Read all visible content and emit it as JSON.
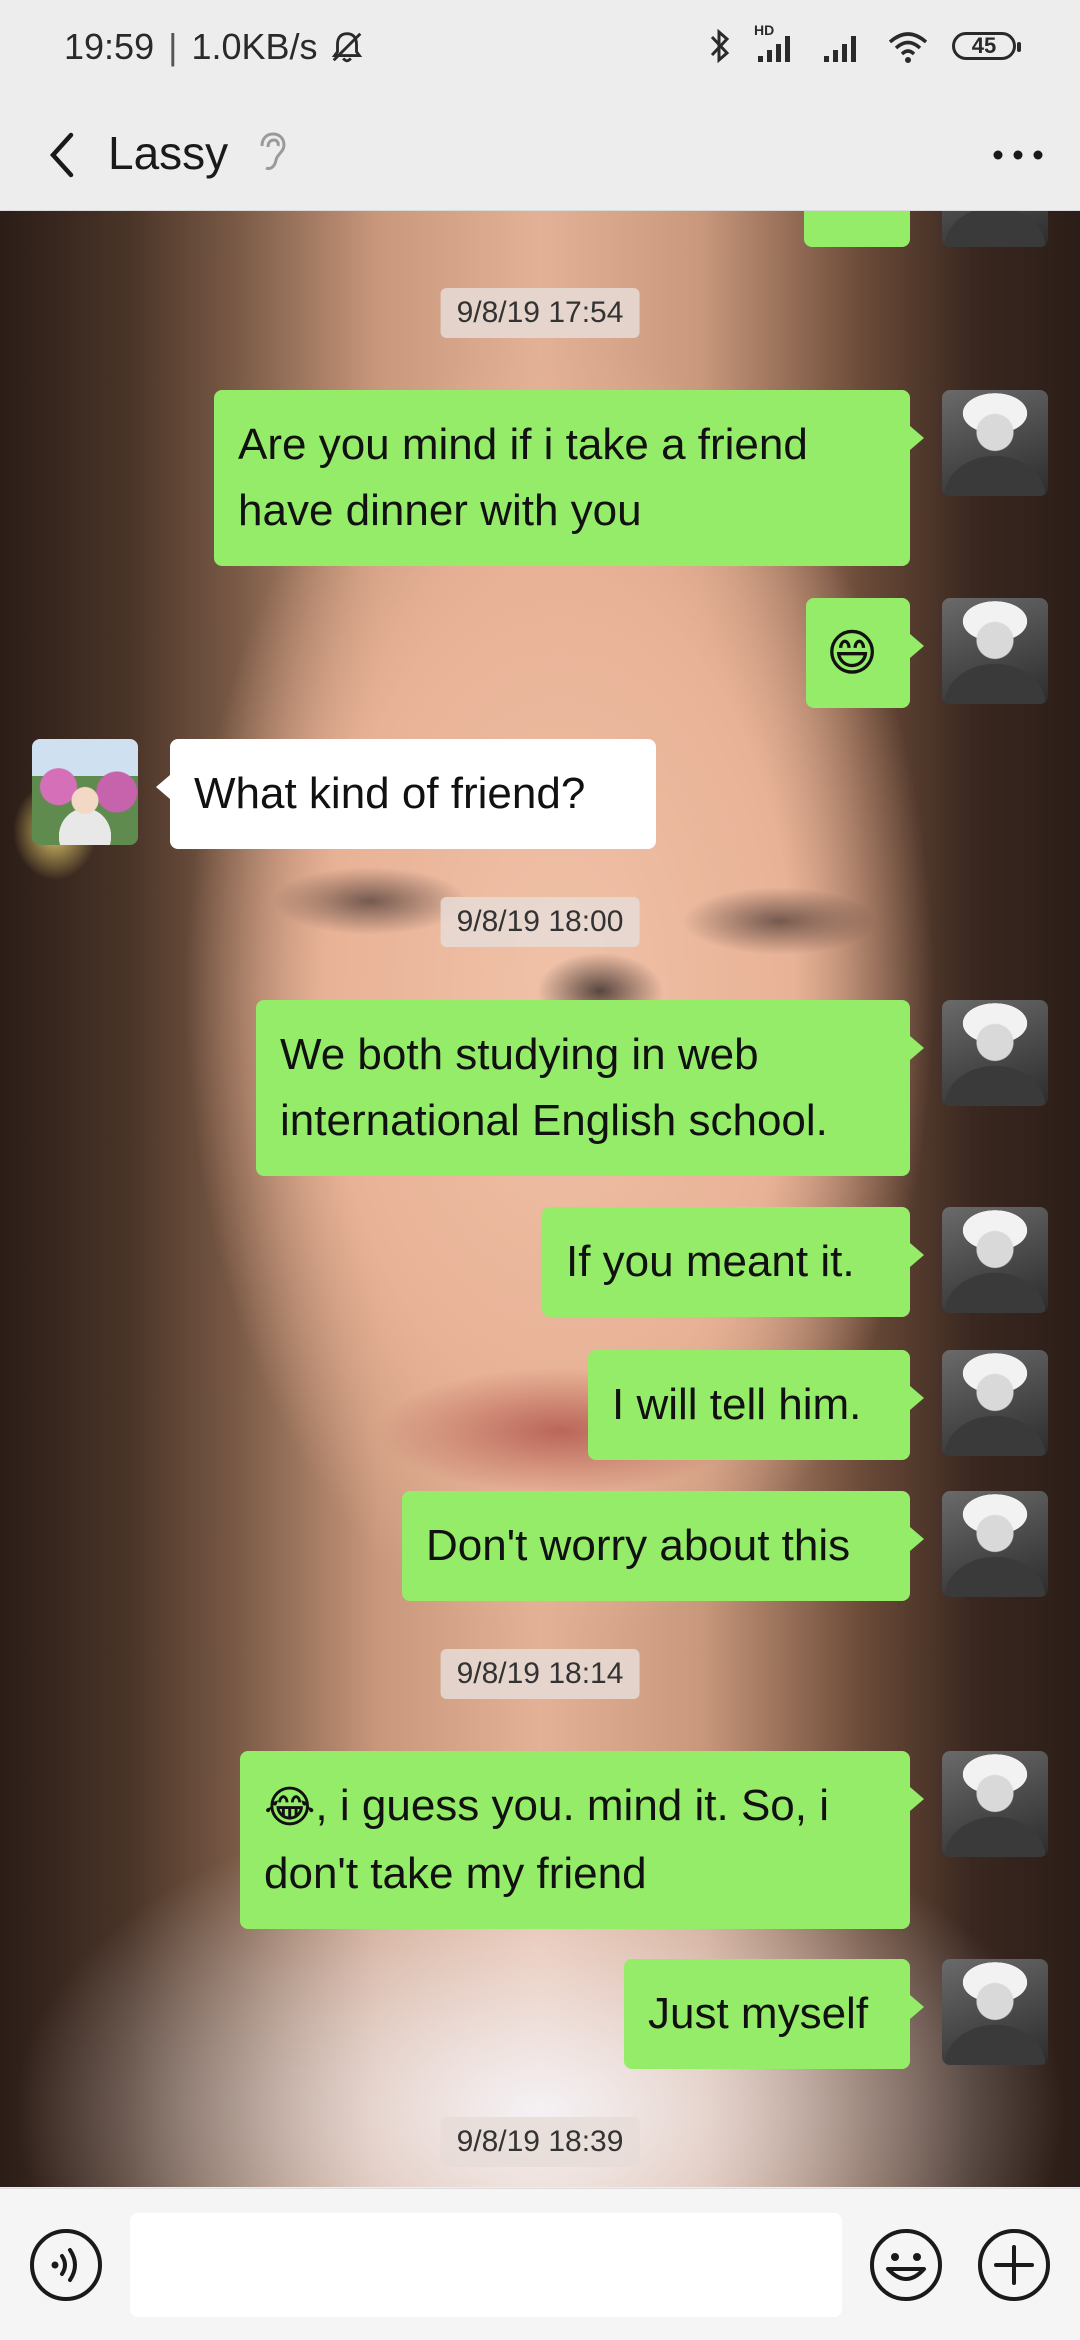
{
  "status_bar": {
    "time": "19:59",
    "separator": "|",
    "speed": "1.0KB/s",
    "network_label": "HD",
    "battery": "45"
  },
  "header": {
    "contact_name": "Lassy"
  },
  "messages": [
    {
      "type": "timestamp",
      "text": "9/8/19 17:54"
    },
    {
      "type": "sent",
      "text": "Are you mind  if i take a friend have dinner with you"
    },
    {
      "type": "sent",
      "text": "😄"
    },
    {
      "type": "received",
      "text": "What kind of friend?"
    },
    {
      "type": "timestamp",
      "text": "9/8/19 18:00"
    },
    {
      "type": "sent",
      "text": "We both studying  in web international English school."
    },
    {
      "type": "sent",
      "text": "If you meant it."
    },
    {
      "type": "sent",
      "text": "I will tell him."
    },
    {
      "type": "sent",
      "text": "Don't worry about this"
    },
    {
      "type": "timestamp",
      "text": "9/8/19 18:14"
    },
    {
      "type": "sent",
      "emoji": "😂",
      "text": ", i guess you. mind it. So, i don't take my friend"
    },
    {
      "type": "sent",
      "text": "Just myself"
    },
    {
      "type": "timestamp",
      "text": "9/8/19 18:39"
    }
  ],
  "input": {
    "value": "",
    "placeholder": ""
  },
  "colors": {
    "sent_bubble": "#95ec69",
    "received_bubble": "#ffffff",
    "header_bg": "#ededed"
  },
  "icons": {
    "back": "chevron-left-icon",
    "ear": "ear-icon",
    "more": "more-dots-icon",
    "voice": "voice-icon",
    "emoji": "smiley-icon",
    "plus": "plus-icon"
  }
}
